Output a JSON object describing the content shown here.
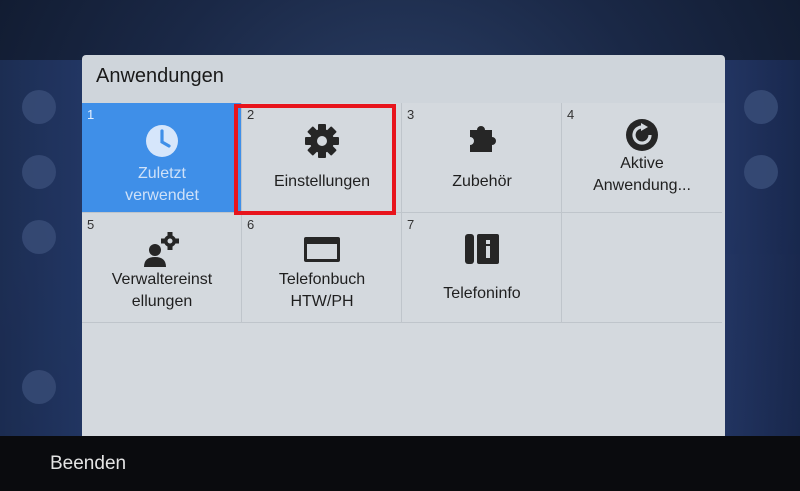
{
  "dialog": {
    "title": "Anwendungen"
  },
  "apps": [
    {
      "number": "1",
      "label_line1": "Zuletzt",
      "label_line2": "verwendet",
      "icon": "clock-icon",
      "selected": true
    },
    {
      "number": "2",
      "label_line1": "Einstellungen",
      "label_line2": "",
      "icon": "gear-icon",
      "selected": false
    },
    {
      "number": "3",
      "label_line1": "Zubehör",
      "label_line2": "",
      "icon": "puzzle-icon",
      "selected": false
    },
    {
      "number": "4",
      "label_line1": "Aktive",
      "label_line2": "Anwendung...",
      "icon": "active-app-icon",
      "selected": false
    },
    {
      "number": "5",
      "label_line1": "Verwaltereinst",
      "label_line2": "ellungen",
      "icon": "admin-settings-icon",
      "selected": false
    },
    {
      "number": "6",
      "label_line1": "Telefonbuch",
      "label_line2": "HTW/PH",
      "icon": "directory-window-icon",
      "selected": false
    },
    {
      "number": "7",
      "label_line1": "Telefoninfo",
      "label_line2": "",
      "icon": "phone-info-icon",
      "selected": false
    }
  ],
  "footer": {
    "softkey_label": "Beenden"
  },
  "colors": {
    "selected_tile": "#3f8fe8",
    "highlight_border": "#e8141c"
  }
}
